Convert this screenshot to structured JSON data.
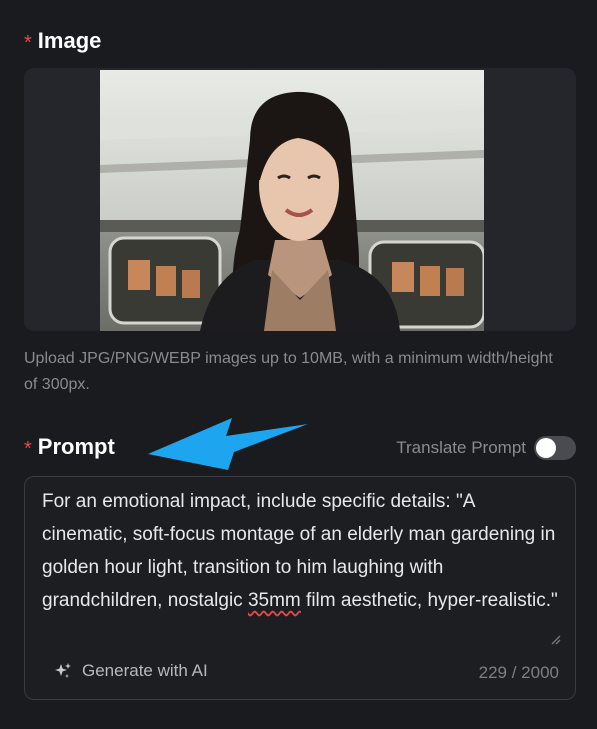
{
  "image_section": {
    "required_mark": "*",
    "label": "Image",
    "hint": "Upload JPG/PNG/WEBP images up to 10MB, with a minimum width/height of 300px."
  },
  "prompt_section": {
    "required_mark": "*",
    "label": "Prompt",
    "translate_label": "Translate Prompt",
    "translate_enabled": false,
    "text_part1": "For an emotional impact, include specific details: \"A cinematic, soft-focus montage of an elderly man gardening in golden hour light, transition to him laughing with grandchildren, nostalgic ",
    "text_misspelled": "35mm",
    "text_part2": " film aesthetic, hyper-realistic.\"",
    "generate_label": "Generate with AI",
    "char_count": "229 / 2000"
  },
  "colors": {
    "background": "#1a1b1e",
    "required": "#e5484d",
    "annotation_arrow": "#1ea5f0"
  },
  "icons": [
    "sparkles-icon",
    "resize-grip-icon"
  ]
}
